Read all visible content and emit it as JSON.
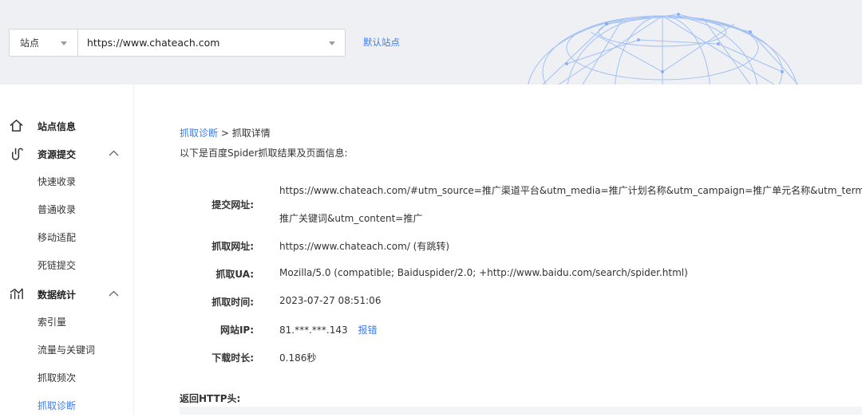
{
  "site_selector": {
    "type_label": "站点",
    "current_url": "https://www.chateach.com",
    "default_site_link": "默认站点"
  },
  "sidebar": {
    "items": [
      {
        "label": "站点信息",
        "icon": "home-icon",
        "kind": "group"
      },
      {
        "label": "资源提交",
        "icon": "resource-submit-icon",
        "kind": "group",
        "expanded": true
      },
      {
        "label": "快速收录",
        "kind": "sub"
      },
      {
        "label": "普通收录",
        "kind": "sub"
      },
      {
        "label": "移动适配",
        "kind": "sub"
      },
      {
        "label": "死链提交",
        "kind": "sub"
      },
      {
        "label": "数据统计",
        "icon": "stats-chart-icon",
        "kind": "group",
        "expanded": true
      },
      {
        "label": "索引量",
        "kind": "sub"
      },
      {
        "label": "流量与关键词",
        "kind": "sub"
      },
      {
        "label": "抓取频次",
        "kind": "sub"
      },
      {
        "label": "抓取诊断",
        "kind": "sub",
        "active": true
      }
    ]
  },
  "main": {
    "breadcrumb": {
      "link": "抓取诊断",
      "separator": ">",
      "current": "抓取详情"
    },
    "intro": "以下是百度Spider抓取结果及页面信息:",
    "details": [
      {
        "label": "提交网址:",
        "value_line1": "https://www.chateach.com/#utm_source=推广渠道平台&utm_media=推广计划名称&utm_campaign=推广单元名称&utm_term=",
        "value_line2": "推广关键词&utm_content=推广"
      },
      {
        "label": "抓取网址:",
        "value": "https://www.chateach.com/ (有跳转)"
      },
      {
        "label": "抓取UA:",
        "value": "Mozilla/5.0 (compatible; Baiduspider/2.0; +http://www.baidu.com/search/spider.html)"
      },
      {
        "label": "抓取时间:",
        "value": "2023-07-27 08:51:06"
      },
      {
        "label": "网站IP:",
        "value": "81.***.***.143",
        "link": "报错"
      },
      {
        "label": "下载时长:",
        "value": "0.186秒"
      }
    ],
    "http_header_title": "返回HTTP头:"
  },
  "colors": {
    "accent": "#3b7cf2",
    "topbar_bg": "#eef0f4",
    "text": "#333333"
  }
}
